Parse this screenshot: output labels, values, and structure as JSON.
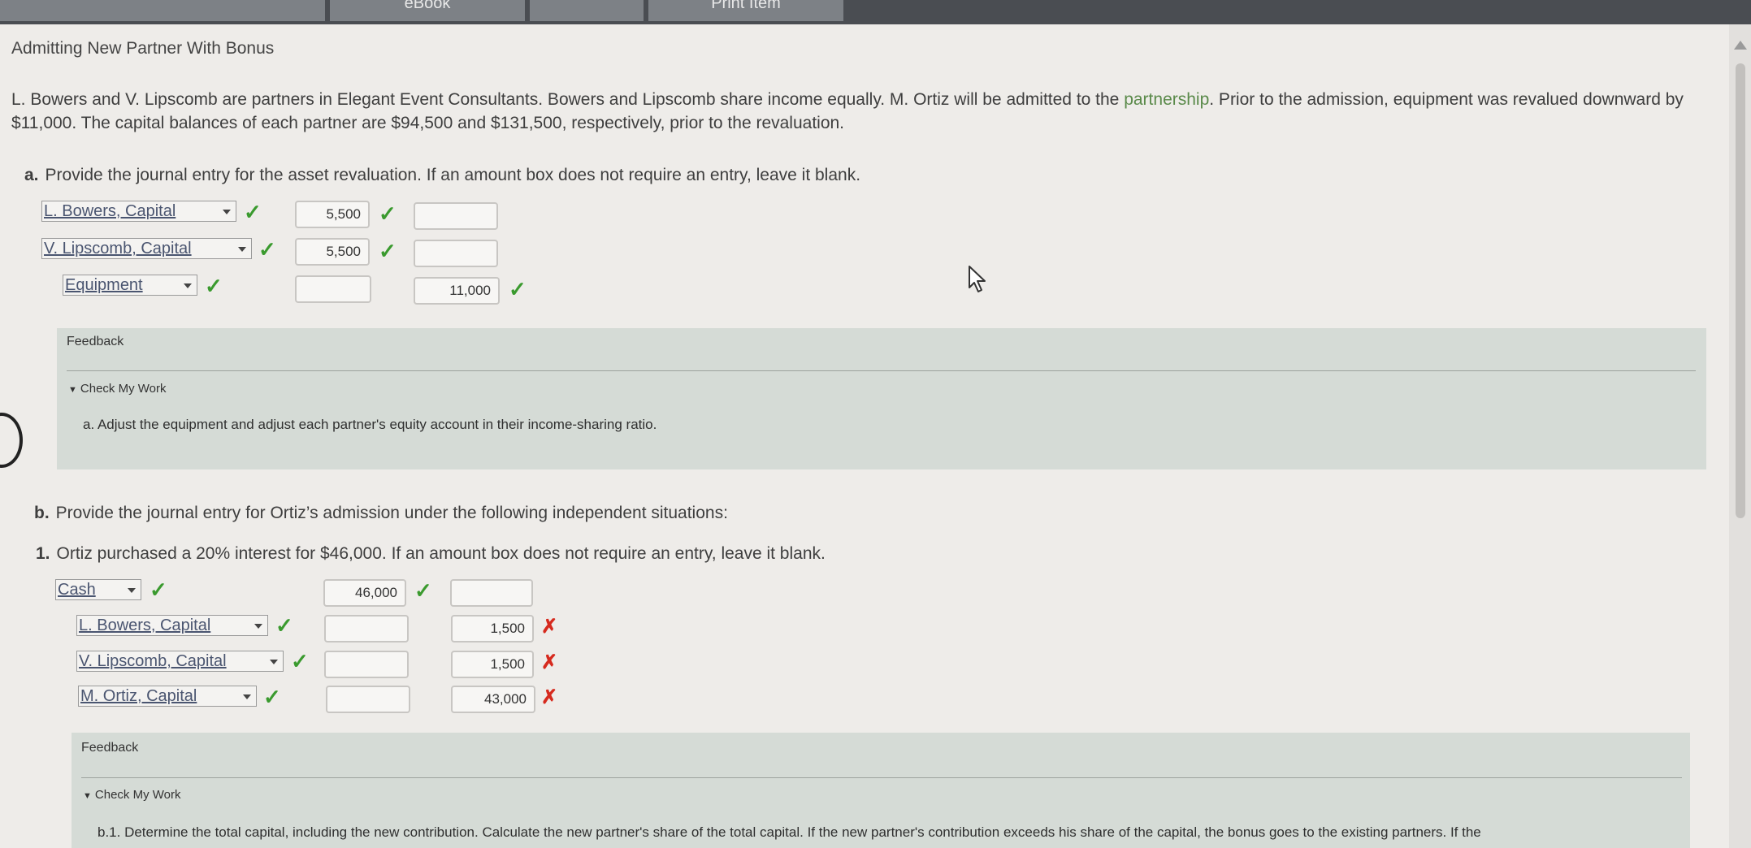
{
  "toolbar": {
    "tab_ebook": "eBook",
    "tab_print": "Print Item"
  },
  "problem": {
    "title": "Admitting New Partner With Bonus",
    "intro_part1": "L. Bowers and V. Lipscomb are partners in Elegant Event Consultants. Bowers and Lipscomb share income equally. M. Ortiz will be admitted to the ",
    "intro_link": "partnership",
    "intro_part2": ". Prior to the admission, equipment was revalued downward by $11,000. The capital balances of each partner are $94,500 and $131,500, respectively, prior to the revaluation."
  },
  "part_a": {
    "letter": "a.",
    "instruction": "Provide the journal entry for the asset revaluation. If an amount box does not require an entry, leave it blank.",
    "rows": [
      {
        "account": "L. Bowers, Capital",
        "debit": "5,500",
        "credit": ""
      },
      {
        "account": "V. Lipscomb, Capital",
        "debit": "5,500",
        "credit": ""
      },
      {
        "account": "Equipment",
        "debit": "",
        "credit": "11,000"
      }
    ],
    "feedback_label": "Feedback",
    "check_my_work": "Check My Work",
    "feedback_text": "a. Adjust the equipment and adjust each partner's equity account in their income-sharing ratio."
  },
  "part_b": {
    "letter": "b.",
    "instruction": "Provide the journal entry for Ortiz’s admission under the following independent situations:",
    "sub1_number": "1.",
    "sub1_instruction": "Ortiz purchased a 20% interest for $46,000. If an amount box does not require an entry, leave it blank.",
    "rows": [
      {
        "account": "Cash",
        "debit": "46,000",
        "credit": ""
      },
      {
        "account": "L. Bowers, Capital",
        "debit": "",
        "credit": "1,500"
      },
      {
        "account": "V. Lipscomb, Capital",
        "debit": "",
        "credit": "1,500"
      },
      {
        "account": "M. Ortiz, Capital",
        "debit": "",
        "credit": "43,000"
      }
    ],
    "feedback_label": "Feedback",
    "check_my_work": "Check My Work",
    "feedback_text": "b.1. Determine the total capital, including the new contribution. Calculate the new partner's share of the total capital. If the new partner's contribution exceeds his share of the capital, the bonus goes to the existing partners. If the"
  },
  "marks": {
    "check": "✓",
    "cross": "✗",
    "disclosure": "▼"
  },
  "colors": {
    "correct": "#3a9a2e",
    "incorrect": "#d62a1e",
    "feedback_bg": "#d5dbd6",
    "link": "#5a8a4a"
  }
}
